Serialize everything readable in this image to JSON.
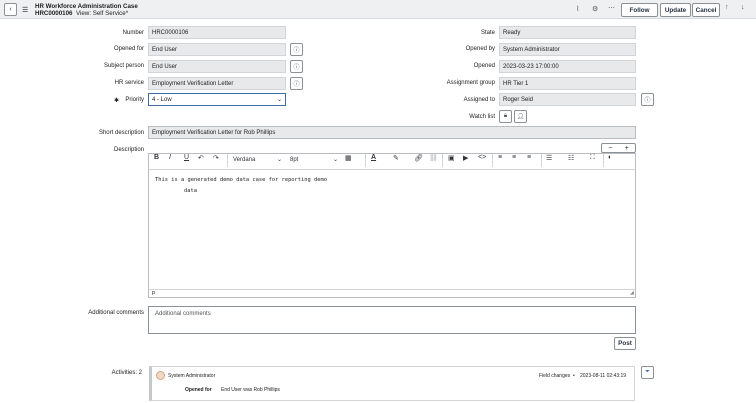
{
  "header": {
    "back_icon": "chevron-left-icon",
    "menu_icon": "hamburger-icon",
    "title_line1": "HR Workforce Administration Case",
    "number": "HRC0000106",
    "view": "View: Self Service*",
    "follow": "Follow",
    "update": "Update",
    "cancel": "Cancel"
  },
  "fields": {
    "number_label": "Number",
    "number": "HRC0000106",
    "opened_for_label": "Opened for",
    "opened_for": "End User",
    "subject_label": "Subject person",
    "subject": "End User",
    "service_label": "HR service",
    "service": "Employment Verification Letter",
    "priority_label": "Priority",
    "priority": "4 - Low",
    "state_label": "State",
    "state": "Ready",
    "opened_by_label": "Opened by",
    "opened_by": "System Administrator",
    "opened_label": "Opened",
    "opened": "2023-03-23 17:00:00",
    "group_label": "Assignment group",
    "group": "HR Tier 1",
    "assigned_label": "Assigned to",
    "assigned": "Roger Seid",
    "watch_label": "Watch list",
    "short_desc_label": "Short description",
    "short_desc": "Employment Verification Letter for Rob Phillips",
    "desc_label": "Description"
  },
  "editor": {
    "font": "Verdana",
    "size": "8pt",
    "text_line1": "This is a generated demo data case for reporting demo",
    "text_line2": "data",
    "path": "p"
  },
  "comments": {
    "label": "Additional comments",
    "placeholder": "Additional comments",
    "post": "Post"
  },
  "activities": {
    "label": "Activities: 2",
    "user": "System Administrator",
    "field_changes": "Field changes",
    "dot": "•",
    "time": "2023-08-11 02:43:19",
    "field": "Opened for",
    "change": "End User  was  Rob Phillips"
  }
}
